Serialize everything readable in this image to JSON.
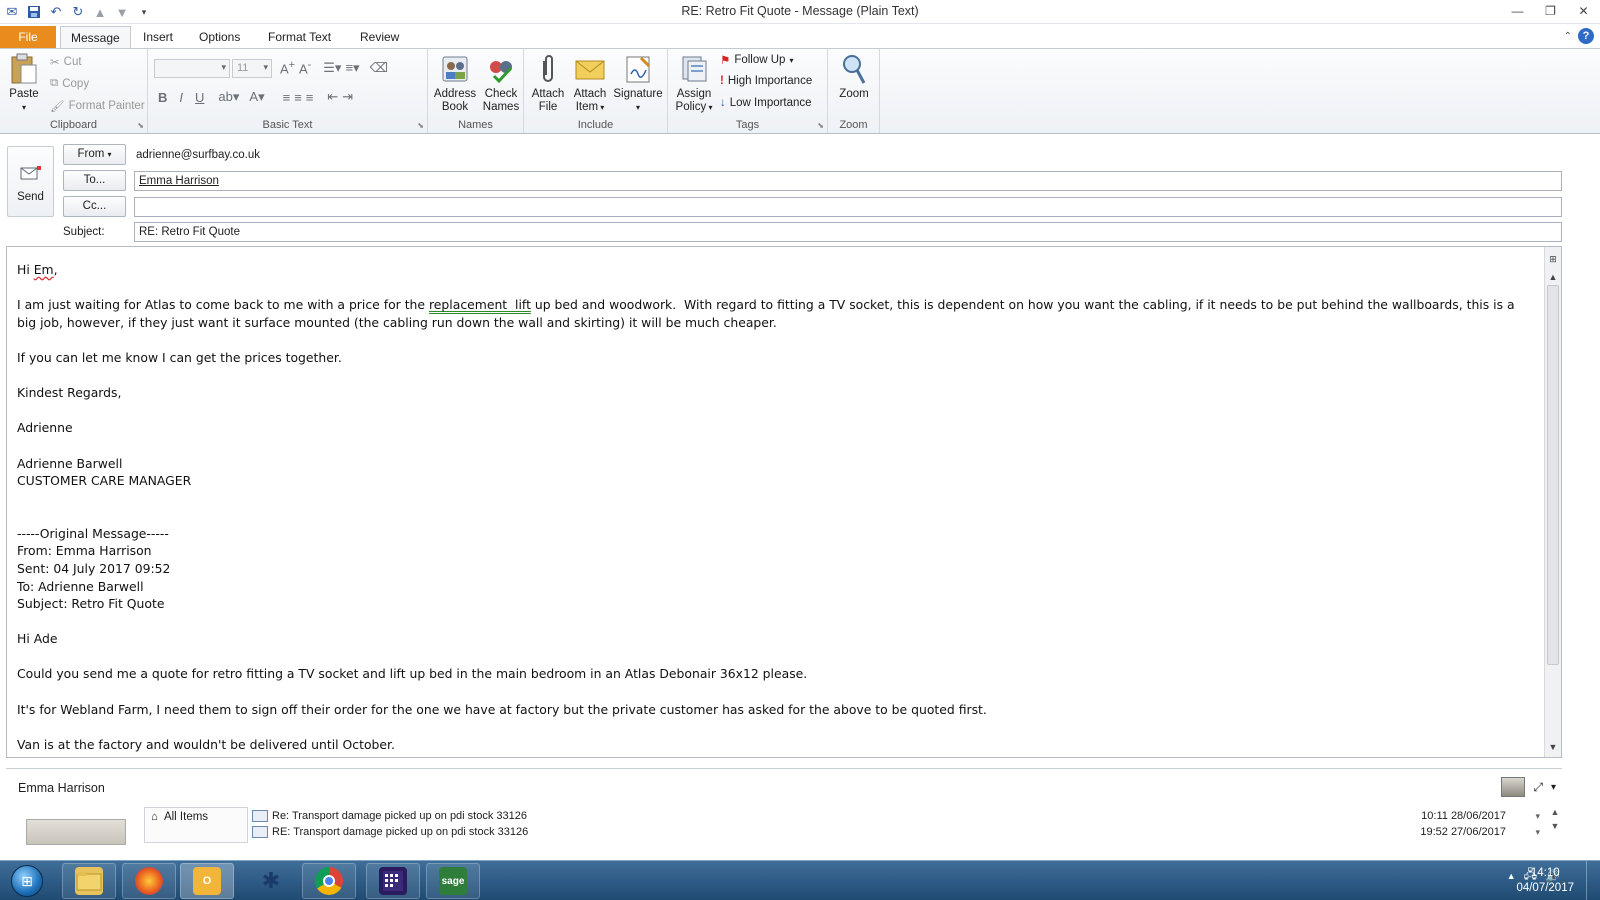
{
  "window": {
    "title": "RE: Retro Fit Quote  -  Message (Plain Text)"
  },
  "ribbon_tabs": [
    "File",
    "Message",
    "Insert",
    "Options",
    "Format Text",
    "Review"
  ],
  "ribbon": {
    "clipboard": {
      "paste": "Paste",
      "cut": "Cut",
      "copy": "Copy",
      "format_painter": "Format Painter",
      "label": "Clipboard"
    },
    "basic_text": {
      "font_size": "11",
      "label": "Basic Text"
    },
    "names": {
      "address_book": "Address Book",
      "check_names": "Check Names",
      "label": "Names"
    },
    "include": {
      "attach_file": "Attach File",
      "attach_item": "Attach Item",
      "signature": "Signature",
      "label": "Include"
    },
    "tags": {
      "assign_policy": "Assign Policy",
      "follow_up": "Follow Up",
      "high_importance": "High Importance",
      "low_importance": "Low Importance",
      "label": "Tags"
    },
    "zoom": {
      "zoom": "Zoom",
      "label": "Zoom"
    }
  },
  "header": {
    "send": "Send",
    "from_button": "From",
    "from_value": "adrienne@surfbay.co.uk",
    "to_button": "To...",
    "to_value": "Emma Harrison",
    "cc_button": "Cc...",
    "cc_value": "",
    "subject_label": "Subject:",
    "subject_value": "RE: Retro Fit Quote"
  },
  "body": {
    "greeting_pre": "Hi ",
    "greeting_name": "Em",
    "greeting_post": ",",
    "para1_a": "I am just waiting for Atlas to come back to me with a price for the ",
    "para1_b": "replacement  lift",
    "para1_c": " up bed and woodwork.  With regard to fitting a TV socket, this is dependent on how you want the cabling, if it needs to be put behind the wallboards, this is a big job, however, if they just want it surface mounted (the cabling run down the wall and skirting) it will be much cheaper.",
    "para2": "If you can let me know I can get the prices together.",
    "closing": "Kindest Regards,",
    "sign_name": "Adrienne",
    "sig_full_name": "Adrienne Barwell",
    "sig_title": "CUSTOMER CARE MANAGER",
    "orig_header": "-----Original Message-----",
    "orig_from": "From: Emma Harrison",
    "orig_sent": "Sent: 04 July 2017 09:52",
    "orig_to": "To: Adrienne Barwell",
    "orig_subject": "Subject: Retro Fit Quote",
    "orig_greeting": "Hi Ade",
    "orig_para1": "Could you send me a quote for retro fitting a TV socket and lift up bed in the main bedroom in an Atlas Debonair 36x12 please.",
    "orig_para2": "It's for Webland Farm, I need them to sign off their order for the one we have at factory but the private customer has asked for the above to be quoted first.",
    "orig_para3": "Van is at the factory and wouldn't be delivered until October."
  },
  "people_pane": {
    "name": "Emma Harrison",
    "all_items": "All Items",
    "mails": [
      {
        "subject": "Re: Transport damage picked up on pdi stock 33126",
        "time": "10:11  28/06/2017"
      },
      {
        "subject": "RE: Transport damage picked up on pdi stock 33126",
        "time": "19:52  27/06/2017"
      }
    ]
  },
  "taskbar": {
    "apps": [
      "windows-explorer",
      "firefox",
      "outlook",
      "network-app",
      "chrome",
      "calendar-app",
      "sage"
    ],
    "sage_label": "sage",
    "time": "14:10",
    "date": "04/07/2017"
  }
}
